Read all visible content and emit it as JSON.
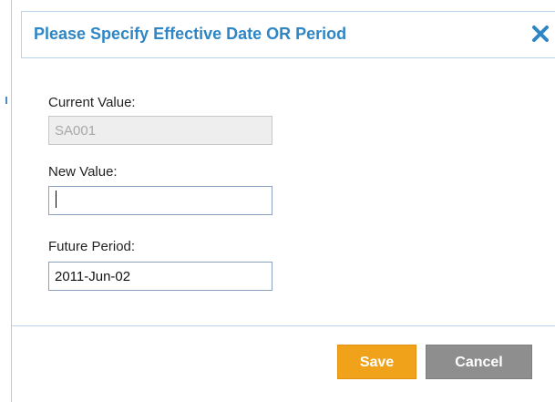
{
  "dialog": {
    "title": "Please Specify Effective Date OR Period",
    "close_icon": "close-icon"
  },
  "form": {
    "current_value": {
      "label": "Current Value:",
      "value": "SA001",
      "disabled": true
    },
    "new_value": {
      "label": "New Value:",
      "value": ""
    },
    "future_period": {
      "label": "Future Period:",
      "value": "2011-Jun-02"
    }
  },
  "buttons": {
    "save_label": "Save",
    "cancel_label": "Cancel"
  },
  "colors": {
    "title": "#2f86c4",
    "save": "#f0a31a",
    "cancel": "#8e8e8e",
    "border": "#b9d3ea"
  }
}
